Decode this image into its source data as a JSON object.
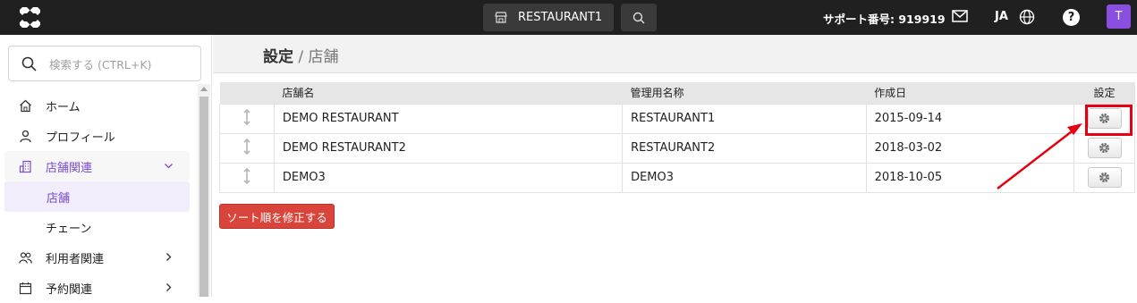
{
  "topbar": {
    "store_button_label": "RESTAURANT1",
    "support_text": "サポート番号: 919919",
    "language": "JA",
    "help_label": "?",
    "avatar_initial": "T"
  },
  "sidebar": {
    "search_placeholder": "検索する (CTRL+K)",
    "items": [
      {
        "label": "ホーム",
        "icon": "home-icon"
      },
      {
        "label": "プロフィール",
        "icon": "person-icon"
      },
      {
        "label": "店舗関連",
        "icon": "store-building-icon",
        "expanded": true
      },
      {
        "label": "店舗",
        "selected": true
      },
      {
        "label": "チェーン"
      },
      {
        "label": "利用者関連",
        "icon": "users-icon"
      },
      {
        "label": "予約関連",
        "icon": "calendar-icon"
      }
    ]
  },
  "breadcrumb": {
    "current": "設定",
    "separator": "/",
    "page": "店舗"
  },
  "table": {
    "headers": [
      "",
      "店舗名",
      "管理用名称",
      "作成日",
      "設定"
    ],
    "rows": [
      {
        "name": "DEMO RESTAURANT",
        "admin_name": "RESTAURANT1",
        "created": "2015-09-14"
      },
      {
        "name": "DEMO RESTAURANT2",
        "admin_name": "RESTAURANT2",
        "created": "2018-03-02"
      },
      {
        "name": "DEMO3",
        "admin_name": "DEMO3",
        "created": "2018-10-05"
      }
    ]
  },
  "sort_button_label": "ソート順を修正する",
  "colors": {
    "topbar": "#202020",
    "accent": "#7a4bd0",
    "danger": "#d9453b",
    "annotation": "#e50012"
  }
}
